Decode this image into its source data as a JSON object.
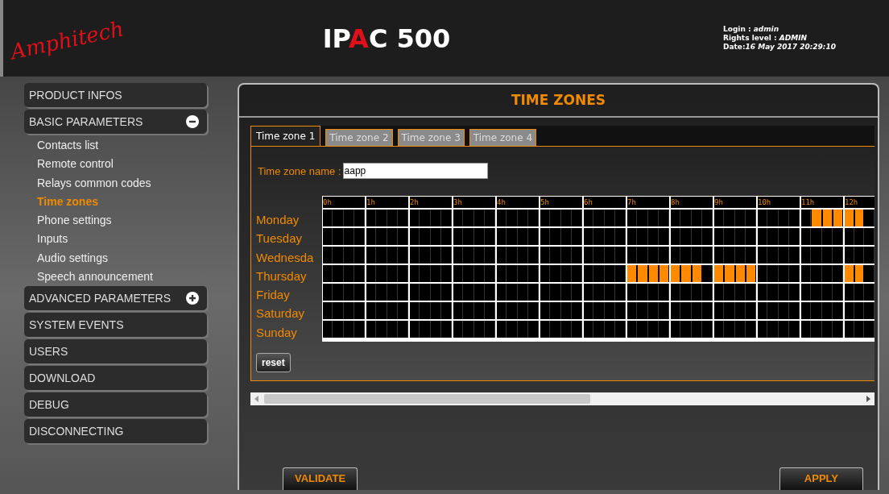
{
  "header": {
    "logo": "Amphitech",
    "title_parts": [
      {
        "text": "IP",
        "color": "#ffffff"
      },
      {
        "text": "A",
        "color": "#e0101a"
      },
      {
        "text": "C 500",
        "color": "#ffffff"
      }
    ],
    "info": [
      "Login : *admin*",
      "Rights level : *ADMIN*",
      "Date:*16 May 2017 20:29:10*"
    ]
  },
  "sidebar": {
    "items": [
      {
        "label": "PRODUCT INFOS"
      },
      {
        "label": "BASIC PARAMETERS",
        "expanded": true,
        "children": [
          {
            "label": "Contacts list",
            "selected": false
          },
          {
            "label": "Remote control",
            "selected": false
          },
          {
            "label": "Relays common codes",
            "selected": false
          },
          {
            "label": "Time zones",
            "selected": true
          },
          {
            "label": "Phone settings",
            "selected": false
          },
          {
            "label": "Inputs",
            "selected": false
          },
          {
            "label": "Audio settings",
            "selected": false
          },
          {
            "label": "Speech announcement",
            "selected": false
          }
        ]
      },
      {
        "label": "ADVANCED PARAMETERS",
        "expanded": false
      },
      {
        "label": "SYSTEM EVENTS"
      },
      {
        "label": "USERS"
      },
      {
        "label": "DOWNLOAD"
      },
      {
        "label": "DEBUG"
      },
      {
        "label": "DISCONNECTING"
      }
    ]
  },
  "panel": {
    "title": "TIME ZONES",
    "tabs": [
      {
        "label": "Time zone 1",
        "selected": true
      },
      {
        "label": "Time zone 2",
        "selected": false
      },
      {
        "label": "Time zone 3",
        "selected": false
      },
      {
        "label": "Time zone 4",
        "selected": false
      }
    ],
    "name_label": "Time zone name :",
    "name_value": "aapp",
    "hours": [
      "0h",
      "1h",
      "2h",
      "3h",
      "4h",
      "5h",
      "6h",
      "7h",
      "8h",
      "9h",
      "10h",
      "11h",
      "12h"
    ],
    "days": [
      {
        "name": "Monday",
        "slots": [
          [
            false,
            false,
            false,
            false
          ],
          [
            false,
            false,
            false,
            false
          ],
          [
            false,
            false,
            false,
            false
          ],
          [
            false,
            false,
            false,
            false
          ],
          [
            false,
            false,
            false,
            false
          ],
          [
            false,
            false,
            false,
            false
          ],
          [
            false,
            false,
            false,
            false
          ],
          [
            false,
            false,
            false,
            false
          ],
          [
            false,
            false,
            false,
            false
          ],
          [
            false,
            false,
            false,
            false
          ],
          [
            false,
            false,
            false,
            false
          ],
          [
            false,
            true,
            true,
            true
          ],
          [
            true,
            true,
            false
          ]
        ]
      },
      {
        "name": "Tuesday",
        "slots": [
          [
            false,
            false,
            false,
            false
          ],
          [
            false,
            false,
            false,
            false
          ],
          [
            false,
            false,
            false,
            false
          ],
          [
            false,
            false,
            false,
            false
          ],
          [
            false,
            false,
            false,
            false
          ],
          [
            false,
            false,
            false,
            false
          ],
          [
            false,
            false,
            false,
            false
          ],
          [
            false,
            false,
            false,
            false
          ],
          [
            false,
            false,
            false,
            false
          ],
          [
            false,
            false,
            false,
            false
          ],
          [
            false,
            false,
            false,
            false
          ],
          [
            false,
            false,
            false,
            false
          ],
          [
            false,
            false,
            false
          ]
        ]
      },
      {
        "name": "Wednesda",
        "slots": [
          [
            false,
            false,
            false,
            false
          ],
          [
            false,
            false,
            false,
            false
          ],
          [
            false,
            false,
            false,
            false
          ],
          [
            false,
            false,
            false,
            false
          ],
          [
            false,
            false,
            false,
            false
          ],
          [
            false,
            false,
            false,
            false
          ],
          [
            false,
            false,
            false,
            false
          ],
          [
            false,
            false,
            false,
            false
          ],
          [
            false,
            false,
            false,
            false
          ],
          [
            false,
            false,
            false,
            false
          ],
          [
            false,
            false,
            false,
            false
          ],
          [
            false,
            false,
            false,
            false
          ],
          [
            false,
            false,
            false
          ]
        ]
      },
      {
        "name": "Thursday",
        "slots": [
          [
            false,
            false,
            false,
            false
          ],
          [
            false,
            false,
            false,
            false
          ],
          [
            false,
            false,
            false,
            false
          ],
          [
            false,
            false,
            false,
            false
          ],
          [
            false,
            false,
            false,
            false
          ],
          [
            false,
            false,
            false,
            false
          ],
          [
            false,
            false,
            false,
            false
          ],
          [
            true,
            true,
            true,
            true
          ],
          [
            true,
            true,
            true,
            false
          ],
          [
            true,
            true,
            true,
            true
          ],
          [
            false,
            false,
            false,
            false
          ],
          [
            false,
            false,
            false,
            false
          ],
          [
            true,
            true,
            false
          ]
        ]
      },
      {
        "name": "Friday",
        "slots": [
          [
            false,
            false,
            false,
            false
          ],
          [
            false,
            false,
            false,
            false
          ],
          [
            false,
            false,
            false,
            false
          ],
          [
            false,
            false,
            false,
            false
          ],
          [
            false,
            false,
            false,
            false
          ],
          [
            false,
            false,
            false,
            false
          ],
          [
            false,
            false,
            false,
            false
          ],
          [
            false,
            false,
            false,
            false
          ],
          [
            false,
            false,
            false,
            false
          ],
          [
            false,
            false,
            false,
            false
          ],
          [
            false,
            false,
            false,
            false
          ],
          [
            false,
            false,
            false,
            false
          ],
          [
            false,
            false,
            false
          ]
        ]
      },
      {
        "name": "Saturday",
        "slots": [
          [
            false,
            false,
            false,
            false
          ],
          [
            false,
            false,
            false,
            false
          ],
          [
            false,
            false,
            false,
            false
          ],
          [
            false,
            false,
            false,
            false
          ],
          [
            false,
            false,
            false,
            false
          ],
          [
            false,
            false,
            false,
            false
          ],
          [
            false,
            false,
            false,
            false
          ],
          [
            false,
            false,
            false,
            false
          ],
          [
            false,
            false,
            false,
            false
          ],
          [
            false,
            false,
            false,
            false
          ],
          [
            false,
            false,
            false,
            false
          ],
          [
            false,
            false,
            false,
            false
          ],
          [
            false,
            false,
            false
          ]
        ]
      },
      {
        "name": "Sunday",
        "slots": [
          [
            false,
            false,
            false,
            false
          ],
          [
            false,
            false,
            false,
            false
          ],
          [
            false,
            false,
            false,
            false
          ],
          [
            false,
            false,
            false,
            false
          ],
          [
            false,
            false,
            false,
            false
          ],
          [
            false,
            false,
            false,
            false
          ],
          [
            false,
            false,
            false,
            false
          ],
          [
            false,
            false,
            false,
            false
          ],
          [
            false,
            false,
            false,
            false
          ],
          [
            false,
            false,
            false,
            false
          ],
          [
            false,
            false,
            false,
            false
          ],
          [
            false,
            false,
            false,
            false
          ],
          [
            false,
            false,
            false
          ]
        ]
      }
    ],
    "reset": "reset"
  },
  "buttons": [
    "VALIDATE",
    "APPLY"
  ]
}
